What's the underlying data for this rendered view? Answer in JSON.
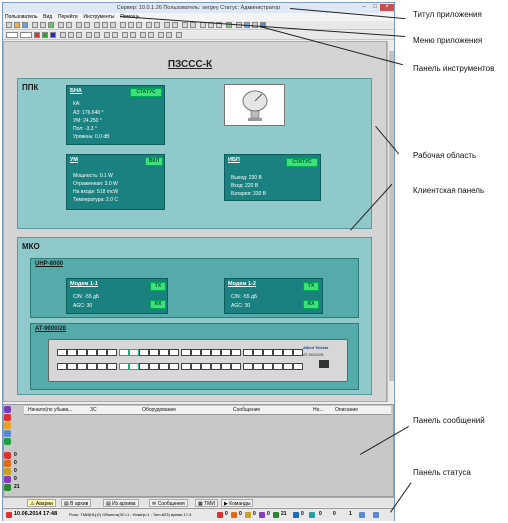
{
  "window": {
    "title": "Сервер: 10.0.1.26 Пользователь: sergey Статус: Администратор"
  },
  "menu": {
    "items": [
      "Пользователь",
      "Вид",
      "Перейти",
      "Инструменты",
      "Помощь"
    ]
  },
  "page": {
    "title": "ПЗССС-К"
  },
  "ppk": {
    "title": "ППК",
    "bna": {
      "name": "БНА",
      "status": "СТАТУС",
      "lines": [
        "КА:",
        "АЗ: 176.640 °",
        "УМ: 24.250 °",
        "Пол: -3.3 °",
        "Уровень: 0.0 dB"
      ]
    },
    "um": {
      "name": "УМ",
      "status": "ВКЛ",
      "lines": [
        "Мощность: 0.1 W",
        "Отраженная: 3.0 W",
        "На входе: 518 mcW",
        "Температура: 2.0 C"
      ]
    },
    "ibp": {
      "name": "ИБП",
      "status": "СТАТУС",
      "lines": [
        "Выход: 230 В",
        "Вход: 220 В",
        "Батарея: 330 В"
      ]
    }
  },
  "mko": {
    "title": "МКО",
    "uhp": {
      "title": "UHP-8000",
      "modem1": {
        "name": "Модем 1-1",
        "tx": "TX",
        "rx": "RX",
        "lines": [
          "C/N: -55 дБ",
          "AGC: 30"
        ]
      },
      "modem2": {
        "name": "Модем 1-2",
        "tx": "TX",
        "rx": "RX",
        "lines": [
          "C/N: -55 дБ",
          "AGC: 30"
        ]
      }
    },
    "switch": {
      "title": "AT-9000/28",
      "brand": "Allied Telesis",
      "model": "AT-9000/28"
    }
  },
  "messages": {
    "columns": [
      "Начало(по убыва...",
      "ЗС",
      "Оборудование",
      "Сообщение",
      "Но...",
      "Описание"
    ],
    "side_counts": [
      "0",
      "0",
      "0",
      "0",
      "21",
      "0",
      "0"
    ]
  },
  "tabs": [
    "Аварии",
    "В архив",
    "Из архива",
    "Сообщения",
    "ТМИ",
    "Команды"
  ],
  "statusbar": {
    "datetime": "10.06.2014 17:48",
    "info": "Роль: ТМИ(НЦ,Е) Объекта(ЗС=1 ; Номер=1 ; Тип=623) время 17:4",
    "counts": [
      "0",
      "0",
      "0",
      "0",
      "21",
      "0",
      "0",
      "0",
      "1"
    ]
  },
  "annotations": [
    "Титул приложения",
    "Меню приложения",
    "Панель инструментов",
    "Рабочая область",
    "Клиентская панель",
    "Панель сообщений",
    "Панель статуса"
  ],
  "colors": {
    "section": "#8fc9c9",
    "device": "#1a8080",
    "status_ok": "#3ee07a",
    "title_bar": "#dfe8f4"
  }
}
